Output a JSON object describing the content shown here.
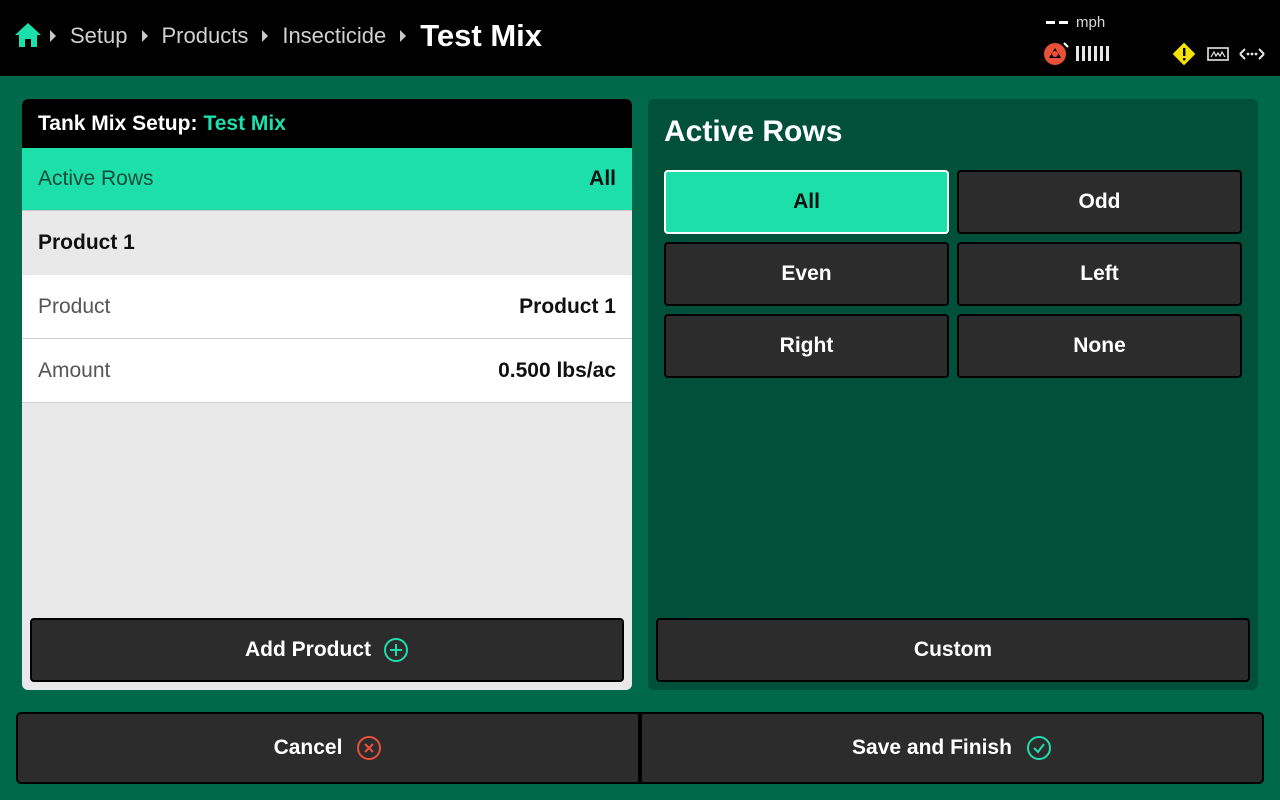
{
  "header": {
    "breadcrumbs": [
      "Setup",
      "Products",
      "Insecticide"
    ],
    "current": "Test Mix",
    "speed_value": "--",
    "speed_unit": "mph"
  },
  "left_panel": {
    "title_prefix": "Tank Mix Setup:",
    "title_accent": "Test Mix",
    "active_rows": {
      "label": "Active Rows",
      "value": "All"
    },
    "section_title": "Product 1",
    "rows": [
      {
        "label": "Product",
        "value": "Product 1"
      },
      {
        "label": "Amount",
        "value": "0.500 lbs/ac"
      }
    ],
    "add_button": "Add Product"
  },
  "right_panel": {
    "title": "Active Rows",
    "options": [
      "All",
      "Odd",
      "Even",
      "Left",
      "Right",
      "None"
    ],
    "selected": "All",
    "custom_button": "Custom"
  },
  "footer": {
    "cancel": "Cancel",
    "save": "Save and Finish"
  },
  "colors": {
    "accent": "#1ddfaa",
    "background": "#00694a",
    "panel_dark": "#00503a",
    "button": "#2c2c2c",
    "cancel_icon": "#e8503a",
    "warning": "#f5e400",
    "gps": "#e8503a"
  },
  "icons": {
    "home": "home-icon",
    "gps": "gps-satellite-icon",
    "warning": "warning-icon",
    "implement": "implement-icon",
    "link": "connection-arrows-icon",
    "add": "plus-circle-icon",
    "cancel": "x-circle-icon",
    "save": "check-circle-icon"
  }
}
